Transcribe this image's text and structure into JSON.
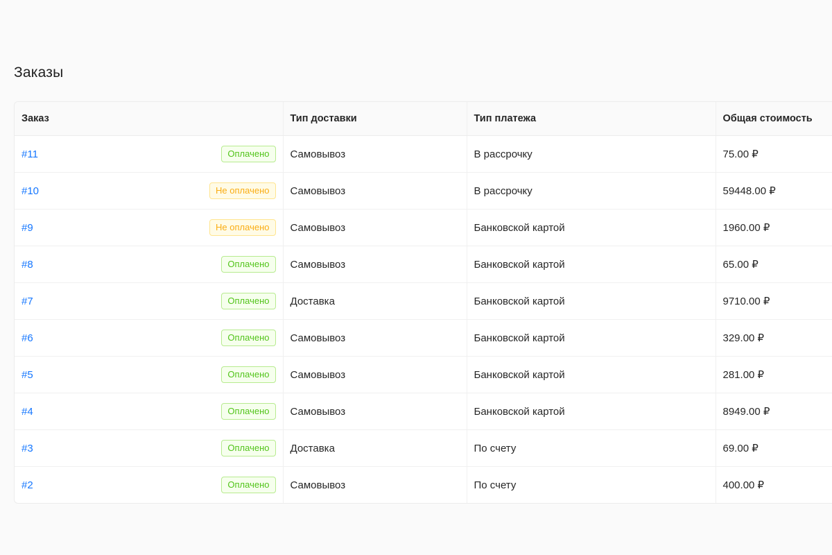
{
  "page": {
    "title": "Заказы"
  },
  "table": {
    "columns": [
      "Заказ",
      "Тип доставки",
      "Тип платежа",
      "Общая стоимость"
    ],
    "rows": [
      {
        "order": "#11",
        "status": "Оплачено",
        "status_type": "paid",
        "delivery": "Самовывоз",
        "payment": "В рассрочку",
        "total": "75.00 ₽"
      },
      {
        "order": "#10",
        "status": "Не оплачено",
        "status_type": "unpaid",
        "delivery": "Самовывоз",
        "payment": "В рассрочку",
        "total": "59448.00 ₽"
      },
      {
        "order": "#9",
        "status": "Не оплачено",
        "status_type": "unpaid",
        "delivery": "Самовывоз",
        "payment": "Банковской картой",
        "total": "1960.00 ₽"
      },
      {
        "order": "#8",
        "status": "Оплачено",
        "status_type": "paid",
        "delivery": "Самовывоз",
        "payment": "Банковской картой",
        "total": "65.00 ₽"
      },
      {
        "order": "#7",
        "status": "Оплачено",
        "status_type": "paid",
        "delivery": "Доставка",
        "payment": "Банковской картой",
        "total": "9710.00 ₽"
      },
      {
        "order": "#6",
        "status": "Оплачено",
        "status_type": "paid",
        "delivery": "Самовывоз",
        "payment": "Банковской картой",
        "total": "329.00 ₽"
      },
      {
        "order": "#5",
        "status": "Оплачено",
        "status_type": "paid",
        "delivery": "Самовывоз",
        "payment": "Банковской картой",
        "total": "281.00 ₽"
      },
      {
        "order": "#4",
        "status": "Оплачено",
        "status_type": "paid",
        "delivery": "Самовывоз",
        "payment": "Банковской картой",
        "total": "8949.00 ₽"
      },
      {
        "order": "#3",
        "status": "Оплачено",
        "status_type": "paid",
        "delivery": "Доставка",
        "payment": "По счету",
        "total": "69.00 ₽"
      },
      {
        "order": "#2",
        "status": "Оплачено",
        "status_type": "paid",
        "delivery": "Самовывоз",
        "payment": "По счету",
        "total": "400.00 ₽"
      }
    ]
  },
  "colors": {
    "link": "#1677ff",
    "paid": "#52c41a",
    "unpaid": "#faad14",
    "background": "#fafafa"
  }
}
